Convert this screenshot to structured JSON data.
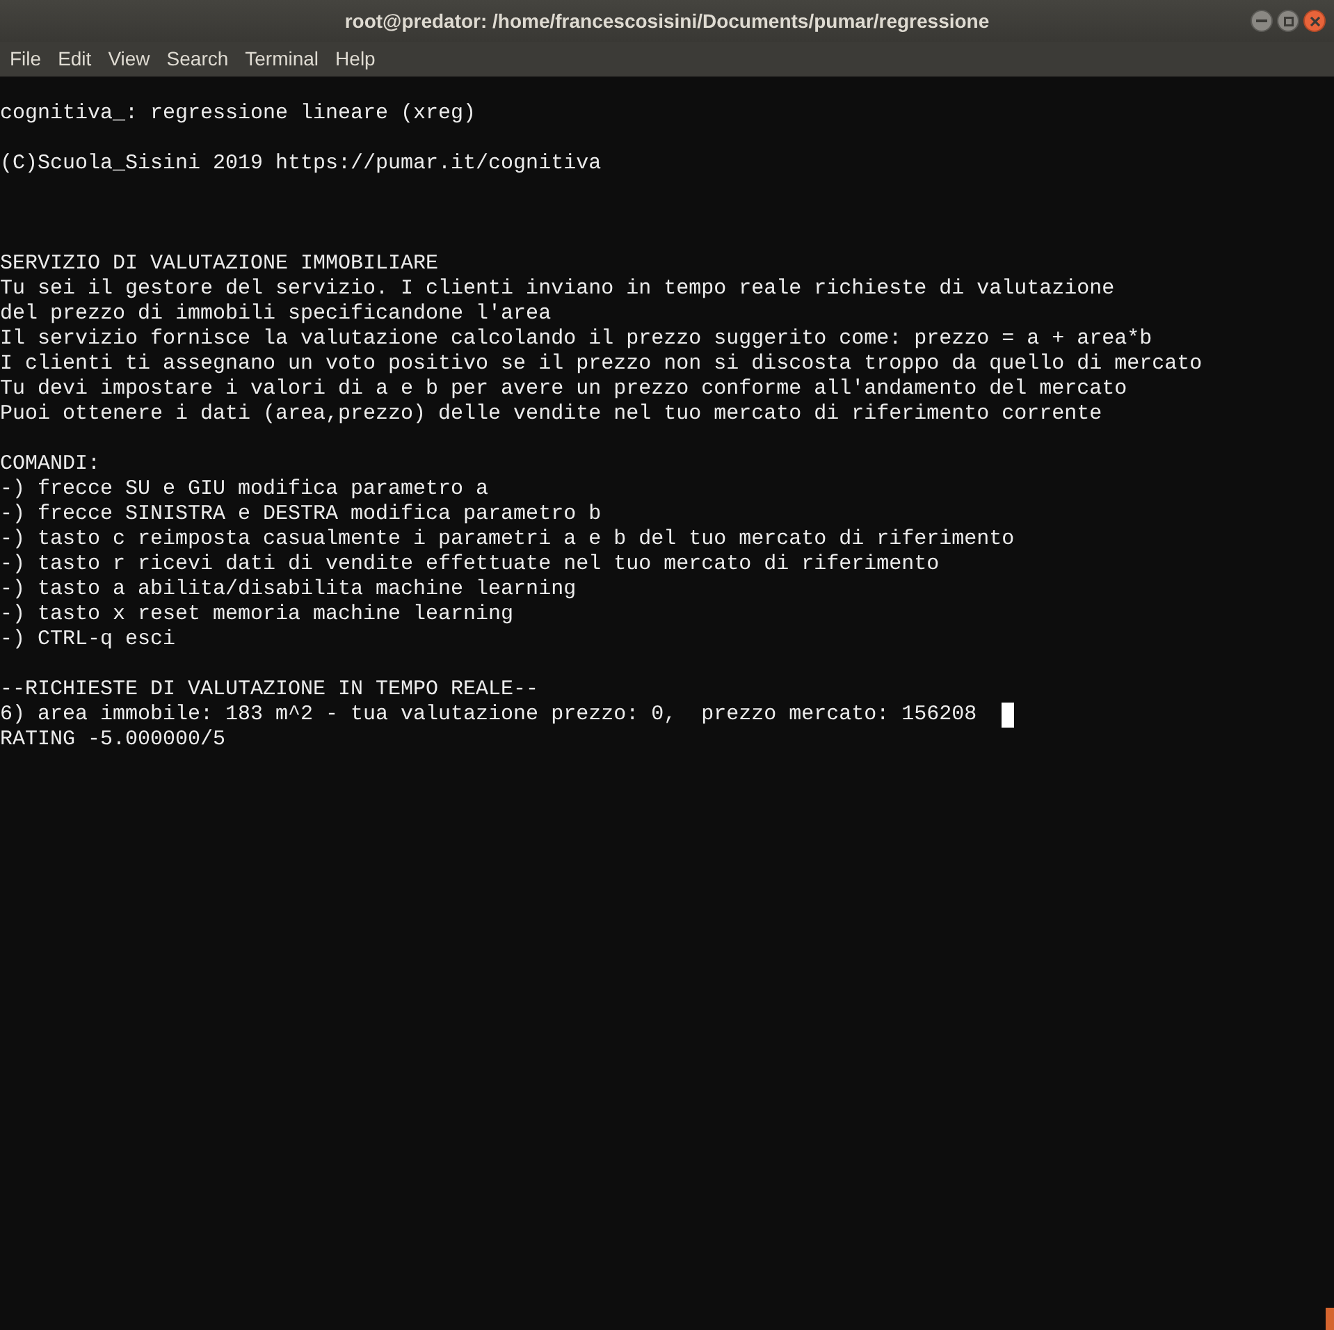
{
  "window": {
    "title": "root@predator: /home/francescosisini/Documents/pumar/regressione"
  },
  "menu": [
    "File",
    "Edit",
    "View",
    "Search",
    "Terminal",
    "Help"
  ],
  "terminal": {
    "lines": [
      {
        "kind": "text",
        "text": "cognitiva_: regressione lineare (xreg)"
      },
      {
        "kind": "blank"
      },
      {
        "kind": "text",
        "text": "(C)Scuola_Sisini 2019 https://pumar.it/cognitiva"
      },
      {
        "kind": "blank"
      },
      {
        "kind": "blank"
      },
      {
        "kind": "blank"
      },
      {
        "kind": "text",
        "text": "SERVIZIO DI VALUTAZIONE IMMOBILIARE"
      },
      {
        "kind": "text",
        "text": "Tu sei il gestore del servizio. I clienti inviano in tempo reale richieste di valutazione"
      },
      {
        "kind": "text",
        "text": "del prezzo di immobili specificandone l'area"
      },
      {
        "kind": "text",
        "text": "Il servizio fornisce la valutazione calcolando il prezzo suggerito come: prezzo = a + area*b"
      },
      {
        "kind": "text",
        "text": "I clienti ti assegnano un voto positivo se il prezzo non si discosta troppo da quello di mercato"
      },
      {
        "kind": "text",
        "text": "Tu devi impostare i valori di a e b per avere un prezzo conforme all'andamento del mercato"
      },
      {
        "kind": "text",
        "text": "Puoi ottenere i dati (area,prezzo) delle vendite nel tuo mercato di riferimento corrente"
      },
      {
        "kind": "blank"
      },
      {
        "kind": "text",
        "text": "COMANDI:"
      },
      {
        "kind": "text",
        "text": "-) frecce SU e GIU modifica parametro a"
      },
      {
        "kind": "text",
        "text": "-) frecce SINISTRA e DESTRA modifica parametro b"
      },
      {
        "kind": "text",
        "text": "-) tasto c reimposta casualmente i parametri a e b del tuo mercato di riferimento"
      },
      {
        "kind": "text",
        "text": "-) tasto r ricevi dati di vendite effettuate nel tuo mercato di riferimento"
      },
      {
        "kind": "text",
        "text": "-) tasto a abilita/disabilita machine learning"
      },
      {
        "kind": "text",
        "text": "-) tasto x reset memoria machine learning"
      },
      {
        "kind": "text",
        "text": "-) CTRL-q esci"
      },
      {
        "kind": "blank"
      },
      {
        "kind": "text",
        "text": "--RICHIESTE DI VALUTAZIONE IN TEMPO REALE--"
      },
      {
        "kind": "cursor",
        "text": "6) area immobile: 183 m^2 - tua valutazione prezzo: 0,  prezzo mercato: 156208"
      },
      {
        "kind": "text",
        "text": "RATING -5.000000/5"
      }
    ]
  }
}
